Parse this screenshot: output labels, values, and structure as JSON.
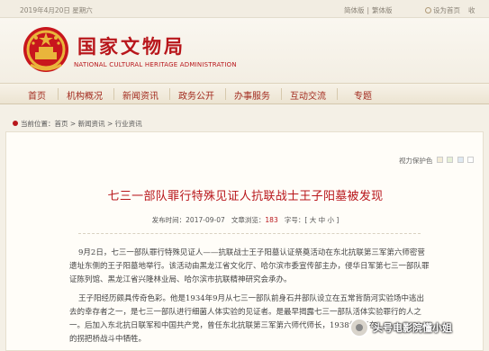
{
  "topbar": {
    "date": "2019年4月20日 星期六",
    "lang_simplified": "简体版",
    "lang_traditional": "繁体版",
    "set_homepage": "设为首页",
    "favorite": "收"
  },
  "header": {
    "title": "国家文物局",
    "subtitle": "NATIONAL CULTURAL HERITAGE ADMINISTRATION"
  },
  "nav": {
    "items": [
      {
        "label": "首页"
      },
      {
        "label": "机构概况"
      },
      {
        "label": "新闻资讯"
      },
      {
        "label": "政务公开"
      },
      {
        "label": "办事服务"
      },
      {
        "label": "互动交流"
      },
      {
        "label": "专题"
      }
    ]
  },
  "breadcrumb": {
    "prefix": "当前位置：",
    "items": [
      "首页",
      "新闻资讯",
      "行业资讯"
    ],
    "separator": " > "
  },
  "article": {
    "font_size_label": "视力保护色",
    "title": "七三一部队罪行特殊见证人抗联战士王子阳墓被发现",
    "meta": {
      "date_label": "发布时间：2017-09-07",
      "hits_label": "文章浏览：",
      "hits": "183",
      "size_prefix": "字号：[",
      "size_large": "大",
      "size_mid": "中",
      "size_small": "小",
      "size_suffix": "]"
    },
    "paragraph1": [
      "9月2日，七三一部队罪行特殊见证人——抗联战士王子阳墓认证祭奠活动在东北抗联第三军第六师密营",
      "遗址东侧的王子阳墓地举行。该活动由黑龙江省文化厅、哈尔滨市委宣传部主办，侵华日军第七三一部队罪",
      "证陈列馆、黑龙江省兴隆林业局、哈尔滨市抗联精神研究会承办。"
    ],
    "paragraph2": [
      "王子阳经历颇具传奇色彩。他是1934年9月从七三一部队前身石井部队设立在五常背荫河实验场中逃出",
      "去的幸存者之一，是七三一部队进行细菌人体实验的见证者。是最早揭露七三一部队活体实验罪行的人之",
      "一。后加入东北抗日联军和中国共产党，曾任东北抗联第三军第六师代师长，1938年6月在"
    ],
    "paragraph2_tail": "的拐把桥战斗中牺牲。"
  },
  "watermark": {
    "text": "头号电影院懂小姐"
  }
}
